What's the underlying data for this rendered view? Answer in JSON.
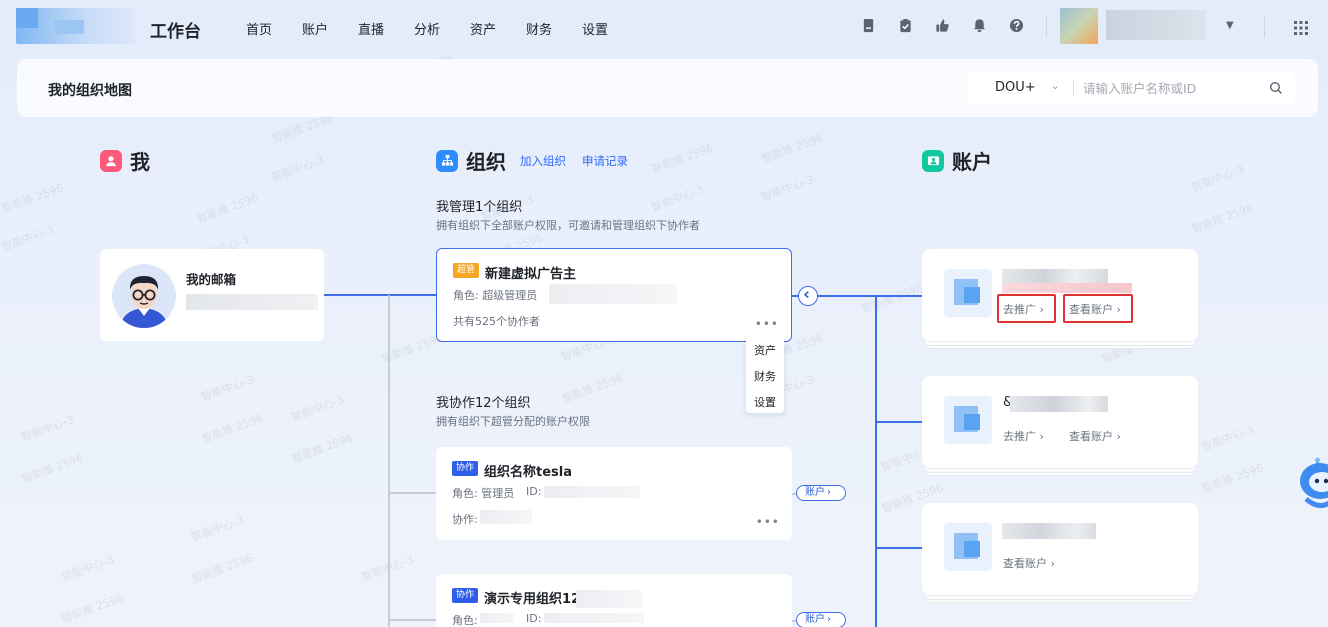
{
  "topbar": {
    "brand": "工作台",
    "nav": [
      "首页",
      "账户",
      "直播",
      "分析",
      "资产",
      "财务",
      "设置"
    ]
  },
  "header": {
    "title": "我的组织地图",
    "select_value": "DOU+",
    "search_placeholder": "请输入账户名称或ID"
  },
  "me": {
    "section_title": "我",
    "name": "我的邮箱"
  },
  "org": {
    "section_title": "组织",
    "link_join": "加入组织",
    "link_records": "申请记录",
    "managed": {
      "title": "我管理1个组织",
      "desc": "拥有组织下全部账户权限，可邀请和管理组织下协作者",
      "card": {
        "tag": "超管",
        "name": "新建虚拟广告主",
        "role": "角色: 超级管理员",
        "collaborators": "共有525个协作者",
        "more": "•••"
      },
      "menu": [
        "资产",
        "财务",
        "设置"
      ]
    },
    "collab": {
      "title": "我协作12个组织",
      "desc": "拥有组织下超管分配的账户权限",
      "cards": [
        {
          "tag": "协作",
          "name": "组织名称tesla",
          "role": "角色: 管理员",
          "id_label": "ID:",
          "collab_label": "协作:",
          "more": "•••",
          "pill": "账户"
        },
        {
          "tag": "协作",
          "name": "演示专用组织12222",
          "role": "角色:",
          "id_label": "ID:",
          "pill": "账户"
        }
      ]
    }
  },
  "accounts": {
    "section_title": "账户",
    "items": [
      {
        "promote": "去推广 ›",
        "view": "查看账户 ›"
      },
      {
        "prefix": "&",
        "promote": "去推广 ›",
        "view": "查看账户 ›"
      },
      {
        "view": "查看账户 ›"
      }
    ]
  },
  "watermark": [
    "智能推 2596",
    "智能中心-3"
  ],
  "colors": {
    "accent": "#3f6ee8",
    "admin_tag": "#f5a623",
    "collab_tag": "#2e5ee8",
    "highlight": "#e03131",
    "me_badge": "#ff5a7a",
    "org_badge": "#2f8cff",
    "acct_badge": "#12c8a0"
  }
}
